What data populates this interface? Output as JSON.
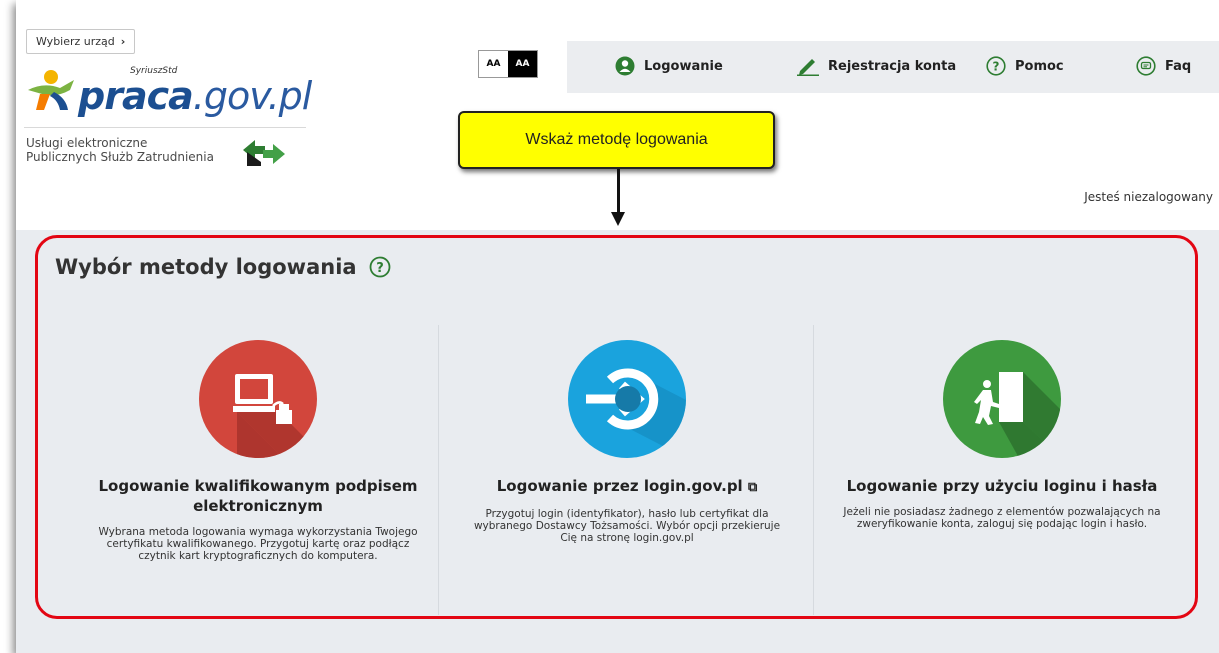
{
  "header": {
    "choose_office": "Wybierz urząd",
    "logo_syriusz": "SyriuszStd",
    "logo_main_bold": "praca",
    "logo_main_rest": ".gov.pl",
    "services_line1": "Usługi elektroniczne",
    "services_line2": "Publicznych Służb Zatrudnienia",
    "contrast_light": "AA",
    "contrast_dark": "AA",
    "not_logged": "Jesteś niezalogowany"
  },
  "nav": {
    "login": "Logowanie",
    "register": "Rejestracja konta",
    "help": "Pomoc",
    "faq": "Faq"
  },
  "callout": {
    "text": "Wskaż metodę logowania"
  },
  "main": {
    "title": "Wybór metody logowania",
    "cards": [
      {
        "title": "Logowanie kwalifikowanym podpisem elektronicznym",
        "text": "Wybrana metoda logowania wymaga wykorzystania Twojego certyfikatu kwalifikowanego. Przygotuj kartę oraz podłącz czytnik kart kryptograficznych do komputera.",
        "color": "#d2463c"
      },
      {
        "title": "Logowanie przez login.gov.pl",
        "text": "Przygotuj login (identyfikator), hasło lub certyfikat dla wybranego Dostawcy Tożsamości. Wybór opcji przekieruje Cię na stronę login.gov.pl",
        "color": "#1aa3dd"
      },
      {
        "title": "Logowanie przy użyciu loginu i hasła",
        "text": "Jeżeli nie posiadasz żadnego z elementów pozwalających na zweryfikowanie konta, zaloguj się podając login i hasło.",
        "color": "#3e9a3f"
      }
    ]
  },
  "colors": {
    "highlight": "#e30613",
    "callout": "#ffff00",
    "brand": "#1c4f91"
  }
}
